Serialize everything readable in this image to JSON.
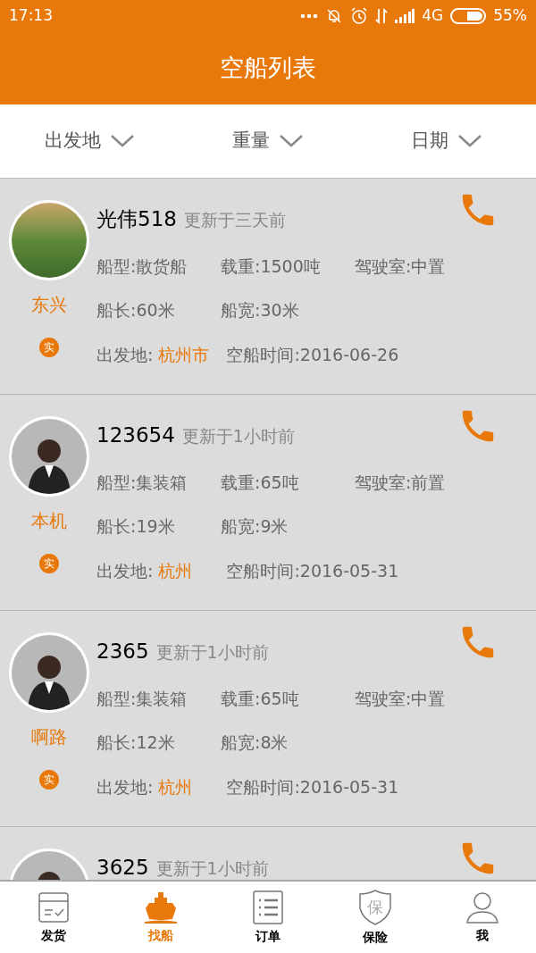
{
  "status_bar": {
    "time": "17:13",
    "network": "4G",
    "battery": "55%"
  },
  "header": {
    "title": "空船列表"
  },
  "filters": [
    {
      "label": "出发地"
    },
    {
      "label": "重量"
    },
    {
      "label": "日期"
    }
  ],
  "cards": [
    {
      "avatar": {
        "kind": "photo"
      },
      "name": "光伟518",
      "updated": "更新于三天前",
      "contact": "东兴",
      "badge": "实",
      "rows": [
        [
          "船型:散货船",
          "载重:1500吨",
          "驾驶室:中置"
        ],
        [
          "船长:60米",
          "船宽:30米"
        ]
      ],
      "origin_label": "出发地:",
      "origin": "杭州市",
      "date": "空船时间:2016-06-26"
    },
    {
      "avatar": {
        "kind": "person"
      },
      "name": "123654",
      "updated": "更新于1小时前",
      "contact": "本机",
      "badge": "实",
      "rows": [
        [
          "船型:集装箱",
          "载重:65吨",
          "驾驶室:前置"
        ],
        [
          "船长:19米",
          "船宽:9米"
        ]
      ],
      "origin_label": "出发地:",
      "origin": "杭州",
      "date": "空船时间:2016-05-31"
    },
    {
      "avatar": {
        "kind": "person"
      },
      "name": "2365",
      "updated": "更新于1小时前",
      "contact": "啊路",
      "badge": "实",
      "rows": [
        [
          "船型:集装箱",
          "载重:65吨",
          "驾驶室:中置"
        ],
        [
          "船长:12米",
          "船宽:8米"
        ]
      ],
      "origin_label": "出发地:",
      "origin": "杭州",
      "date": "空船时间:2016-05-31"
    },
    {
      "avatar": {
        "kind": "person"
      },
      "name": "3625",
      "updated": "更新于1小时前"
    }
  ],
  "nav": [
    {
      "kind": "box",
      "label": "发货",
      "selected": false
    },
    {
      "kind": "ship",
      "label": "找船",
      "selected": true
    },
    {
      "kind": "list",
      "label": "订单",
      "selected": false
    },
    {
      "kind": "shield",
      "label": "保险",
      "glyph": "保",
      "selected": false
    },
    {
      "kind": "person",
      "label": "我",
      "selected": false
    }
  ]
}
